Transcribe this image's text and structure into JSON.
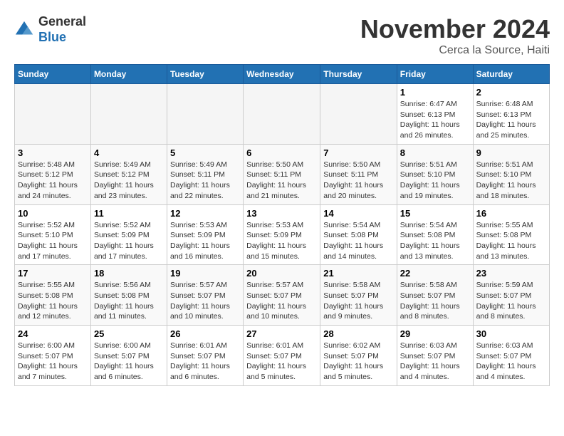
{
  "header": {
    "logo_general": "General",
    "logo_blue": "Blue",
    "month_title": "November 2024",
    "location": "Cerca la Source, Haiti"
  },
  "weekdays": [
    "Sunday",
    "Monday",
    "Tuesday",
    "Wednesday",
    "Thursday",
    "Friday",
    "Saturday"
  ],
  "weeks": [
    [
      {
        "day": "",
        "info": ""
      },
      {
        "day": "",
        "info": ""
      },
      {
        "day": "",
        "info": ""
      },
      {
        "day": "",
        "info": ""
      },
      {
        "day": "",
        "info": ""
      },
      {
        "day": "1",
        "info": "Sunrise: 6:47 AM\nSunset: 6:13 PM\nDaylight: 11 hours\nand 26 minutes."
      },
      {
        "day": "2",
        "info": "Sunrise: 6:48 AM\nSunset: 6:13 PM\nDaylight: 11 hours\nand 25 minutes."
      }
    ],
    [
      {
        "day": "3",
        "info": "Sunrise: 5:48 AM\nSunset: 5:12 PM\nDaylight: 11 hours\nand 24 minutes."
      },
      {
        "day": "4",
        "info": "Sunrise: 5:49 AM\nSunset: 5:12 PM\nDaylight: 11 hours\nand 23 minutes."
      },
      {
        "day": "5",
        "info": "Sunrise: 5:49 AM\nSunset: 5:11 PM\nDaylight: 11 hours\nand 22 minutes."
      },
      {
        "day": "6",
        "info": "Sunrise: 5:50 AM\nSunset: 5:11 PM\nDaylight: 11 hours\nand 21 minutes."
      },
      {
        "day": "7",
        "info": "Sunrise: 5:50 AM\nSunset: 5:11 PM\nDaylight: 11 hours\nand 20 minutes."
      },
      {
        "day": "8",
        "info": "Sunrise: 5:51 AM\nSunset: 5:10 PM\nDaylight: 11 hours\nand 19 minutes."
      },
      {
        "day": "9",
        "info": "Sunrise: 5:51 AM\nSunset: 5:10 PM\nDaylight: 11 hours\nand 18 minutes."
      }
    ],
    [
      {
        "day": "10",
        "info": "Sunrise: 5:52 AM\nSunset: 5:10 PM\nDaylight: 11 hours\nand 17 minutes."
      },
      {
        "day": "11",
        "info": "Sunrise: 5:52 AM\nSunset: 5:09 PM\nDaylight: 11 hours\nand 17 minutes."
      },
      {
        "day": "12",
        "info": "Sunrise: 5:53 AM\nSunset: 5:09 PM\nDaylight: 11 hours\nand 16 minutes."
      },
      {
        "day": "13",
        "info": "Sunrise: 5:53 AM\nSunset: 5:09 PM\nDaylight: 11 hours\nand 15 minutes."
      },
      {
        "day": "14",
        "info": "Sunrise: 5:54 AM\nSunset: 5:08 PM\nDaylight: 11 hours\nand 14 minutes."
      },
      {
        "day": "15",
        "info": "Sunrise: 5:54 AM\nSunset: 5:08 PM\nDaylight: 11 hours\nand 13 minutes."
      },
      {
        "day": "16",
        "info": "Sunrise: 5:55 AM\nSunset: 5:08 PM\nDaylight: 11 hours\nand 13 minutes."
      }
    ],
    [
      {
        "day": "17",
        "info": "Sunrise: 5:55 AM\nSunset: 5:08 PM\nDaylight: 11 hours\nand 12 minutes."
      },
      {
        "day": "18",
        "info": "Sunrise: 5:56 AM\nSunset: 5:08 PM\nDaylight: 11 hours\nand 11 minutes."
      },
      {
        "day": "19",
        "info": "Sunrise: 5:57 AM\nSunset: 5:07 PM\nDaylight: 11 hours\nand 10 minutes."
      },
      {
        "day": "20",
        "info": "Sunrise: 5:57 AM\nSunset: 5:07 PM\nDaylight: 11 hours\nand 10 minutes."
      },
      {
        "day": "21",
        "info": "Sunrise: 5:58 AM\nSunset: 5:07 PM\nDaylight: 11 hours\nand 9 minutes."
      },
      {
        "day": "22",
        "info": "Sunrise: 5:58 AM\nSunset: 5:07 PM\nDaylight: 11 hours\nand 8 minutes."
      },
      {
        "day": "23",
        "info": "Sunrise: 5:59 AM\nSunset: 5:07 PM\nDaylight: 11 hours\nand 8 minutes."
      }
    ],
    [
      {
        "day": "24",
        "info": "Sunrise: 6:00 AM\nSunset: 5:07 PM\nDaylight: 11 hours\nand 7 minutes."
      },
      {
        "day": "25",
        "info": "Sunrise: 6:00 AM\nSunset: 5:07 PM\nDaylight: 11 hours\nand 6 minutes."
      },
      {
        "day": "26",
        "info": "Sunrise: 6:01 AM\nSunset: 5:07 PM\nDaylight: 11 hours\nand 6 minutes."
      },
      {
        "day": "27",
        "info": "Sunrise: 6:01 AM\nSunset: 5:07 PM\nDaylight: 11 hours\nand 5 minutes."
      },
      {
        "day": "28",
        "info": "Sunrise: 6:02 AM\nSunset: 5:07 PM\nDaylight: 11 hours\nand 5 minutes."
      },
      {
        "day": "29",
        "info": "Sunrise: 6:03 AM\nSunset: 5:07 PM\nDaylight: 11 hours\nand 4 minutes."
      },
      {
        "day": "30",
        "info": "Sunrise: 6:03 AM\nSunset: 5:07 PM\nDaylight: 11 hours\nand 4 minutes."
      }
    ]
  ]
}
